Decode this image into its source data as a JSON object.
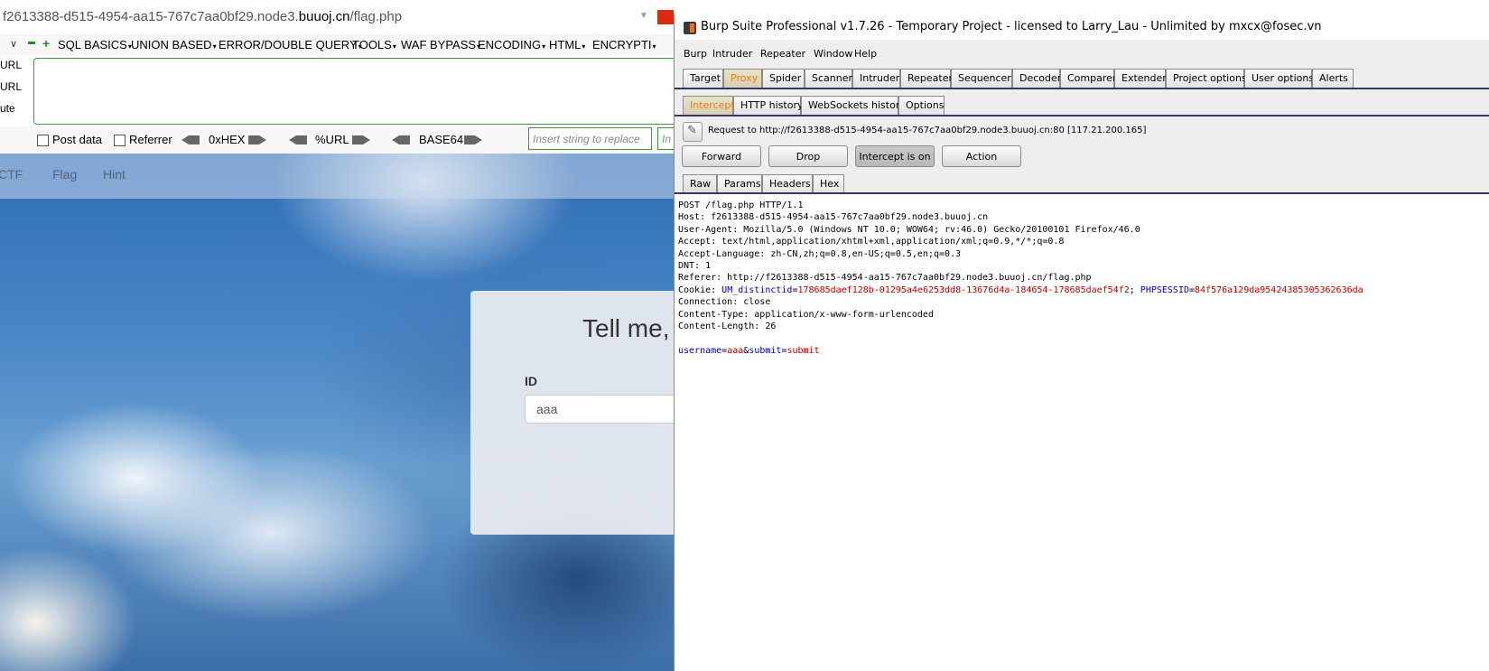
{
  "browser": {
    "url_prefix": "f2613388-d515-4954-aa15-767c7aa0bf29.node3.",
    "url_domain": "buuoj.cn",
    "url_path": "/flag.php"
  },
  "hackbar": {
    "menus": [
      "SQL BASICS",
      "UNION BASED",
      "ERROR/DOUBLE QUERY",
      "TOOLS",
      "WAF BYPASS",
      "ENCODING",
      "HTML",
      "ENCRYPTI"
    ],
    "side_labels": [
      "URL",
      "URL",
      "ute"
    ],
    "post_data_label": "Post data",
    "referrer_label": "Referrer",
    "hex_label": "0xHEX",
    "url_label": "%URL",
    "base64_label": "BASE64",
    "replace_placeholder": "Insert string to replace",
    "replace2_placeholder": "In"
  },
  "site": {
    "nav": [
      "CTF",
      "Flag",
      "Hint"
    ],
    "card_title": "Tell me,",
    "id_label": "ID",
    "id_value": "aaa"
  },
  "burp": {
    "title": "Burp Suite Professional v1.7.26 - Temporary Project - licensed to Larry_Lau - Unlimited by mxcx@fosec.vn",
    "menu": [
      "Burp",
      "Intruder",
      "Repeater",
      "Window",
      "Help"
    ],
    "main_tabs": [
      "Target",
      "Proxy",
      "Spider",
      "Scanner",
      "Intruder",
      "Repeater",
      "Sequencer",
      "Decoder",
      "Comparer",
      "Extender",
      "Project options",
      "User options",
      "Alerts"
    ],
    "main_selected": "Proxy",
    "proxy_tabs": [
      "Intercept",
      "HTTP history",
      "WebSockets history",
      "Options"
    ],
    "proxy_selected": "Intercept",
    "request_to": "Request to http://f2613388-d515-4954-aa15-767c7aa0bf29.node3.buuoj.cn:80  [117.21.200.165]",
    "buttons": [
      "Forward",
      "Drop",
      "Intercept is on",
      "Action"
    ],
    "view_tabs": [
      "Raw",
      "Params",
      "Headers",
      "Hex"
    ],
    "view_selected": "Raw",
    "request_lines": [
      "POST /flag.php HTTP/1.1",
      "Host: f2613388-d515-4954-aa15-767c7aa0bf29.node3.buuoj.cn",
      "User-Agent: Mozilla/5.0 (Windows NT 10.0; WOW64; rv:46.0) Gecko/20100101 Firefox/46.0",
      "Accept: text/html,application/xhtml+xml,application/xml;q=0.9,*/*;q=0.8",
      "Accept-Language: zh-CN,zh;q=0.8,en-US;q=0.5,en;q=0.3",
      "DNT: 1",
      "Referer: http://f2613388-d515-4954-aa15-767c7aa0bf29.node3.buuoj.cn/flag.php"
    ],
    "cookie": {
      "prefix": "Cookie: ",
      "k1": "UM_distinctid",
      "v1": "178685daef128b-01295a4e6253dd8-13676d4a-184654-178685daef54f2",
      "sep": "; ",
      "k2": "PHPSESSID",
      "v2": "84f576a129da95424385305362636da"
    },
    "request_lines_after": [
      "Connection: close",
      "Content-Type: application/x-www-form-urlencoded",
      "Content-Length: 26"
    ],
    "body": {
      "k1": "username",
      "v1": "aaa",
      "amp": "&",
      "k2": "submit",
      "v2": "submit",
      "eq": "="
    }
  },
  "colors": {
    "burp_selected_tab": "#e0821a",
    "hackbar_border": "#3c9a3c",
    "param_name": "#0000c8",
    "param_value": "#c00000"
  }
}
